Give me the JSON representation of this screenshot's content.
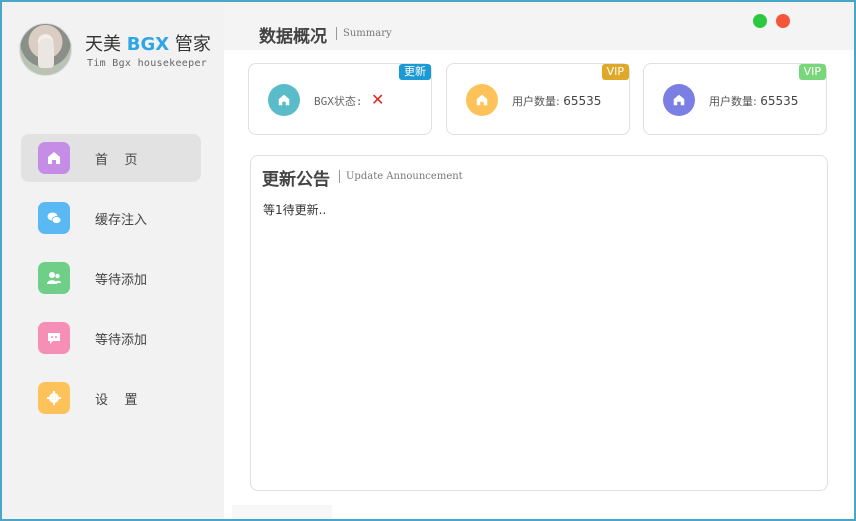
{
  "brand": {
    "title_prefix": "天美 ",
    "title_highlight": "BGX",
    "title_suffix": " 管家",
    "subtitle": "Tim Bgx housekeeper"
  },
  "nav": {
    "items": [
      {
        "label": "首    页",
        "icon": "home-icon",
        "color": "#c58de6",
        "active": true
      },
      {
        "label": "缓存注入",
        "icon": "wechat-icon",
        "color": "#5ab8f2",
        "active": false
      },
      {
        "label": "等待添加",
        "icon": "users-icon",
        "color": "#6fcf88",
        "active": false
      },
      {
        "label": "等待添加",
        "icon": "message-icon",
        "color": "#f58fb6",
        "active": false
      },
      {
        "label": "设    置",
        "icon": "gear-icon",
        "color": "#fdc35a",
        "active": false
      }
    ]
  },
  "header": {
    "title": "数据概况",
    "subtitle": "Summary"
  },
  "cards": [
    {
      "label": "BGX状态:",
      "value": "",
      "status_icon": "cross-icon",
      "badge": "更新",
      "badge_color": "#1c9ad6",
      "icon_color": "#5bbcc9"
    },
    {
      "label": "用户数量:",
      "value": "65535",
      "badge": "VIP",
      "badge_color": "#e0a828",
      "icon_color": "#fdc35a"
    },
    {
      "label": "用户数量:",
      "value": "65535",
      "badge": "VIP",
      "badge_color": "#7ad67a",
      "icon_color": "#7b7fe3"
    }
  ],
  "announcement": {
    "title": "更新公告",
    "subtitle": "Update Announcement",
    "body": "等1待更新.."
  },
  "window_controls": {
    "minimize_color": "#2cc840",
    "close_color": "#f4553b"
  }
}
